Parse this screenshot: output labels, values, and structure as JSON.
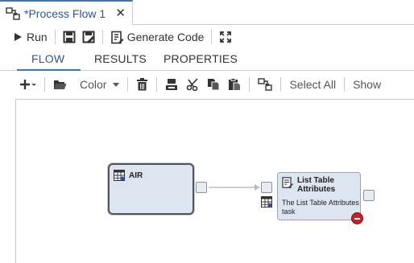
{
  "tab": {
    "title": "*Process Flow 1",
    "close": "✕"
  },
  "toolbar": {
    "run_label": "Run",
    "generate_code_label": "Generate Code"
  },
  "subtabs": [
    {
      "label": "FLOW",
      "active": true
    },
    {
      "label": "RESULTS",
      "active": false
    },
    {
      "label": "PROPERTIES",
      "active": false
    }
  ],
  "flow_toolbar": {
    "color_label": "Color",
    "select_all_label": "Select All",
    "show_label": "Show"
  },
  "nodes": [
    {
      "title": "AIR"
    },
    {
      "title": "List Table Attributes",
      "description": "The List Table Attributes task"
    }
  ],
  "colors": {
    "accent": "#3d74b6",
    "node_fill": "#dde5f1",
    "error": "#c8202a"
  }
}
